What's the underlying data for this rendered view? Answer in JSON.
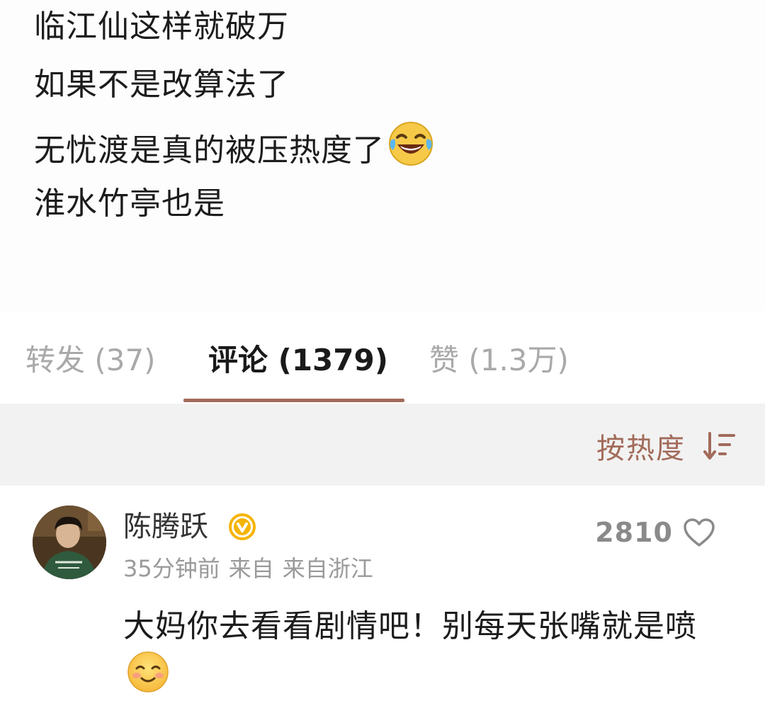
{
  "post": {
    "lines": [
      "临江仙这样就破万",
      "如果不是改算法了",
      "无忧渡是真的被压热度了",
      "淮水竹亭也是"
    ],
    "line3_emoji": "laughing-tears-emoji"
  },
  "tabs": {
    "repost": "转发 (37)",
    "comment": "评论 (1379)",
    "like": "赞 (1.3万)",
    "active": "comment",
    "accent_color": "#a26b5a"
  },
  "sort": {
    "label": "按热度",
    "icon": "sort-descending-icon"
  },
  "comment": {
    "username": "陈腾跃",
    "verified_icon": "verified-badge-icon",
    "time": "35分钟前",
    "source_prefix": "来自",
    "source": "来自浙江",
    "like_count": "2810",
    "text": "大妈你去看看剧情吧！别每天张嘴就是喷",
    "text_emoji": "smile-emoji"
  }
}
